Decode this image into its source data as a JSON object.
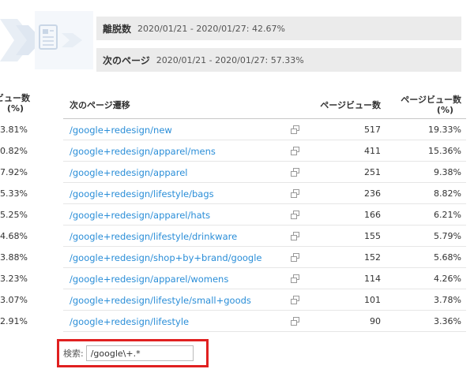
{
  "metrics": {
    "exit": {
      "label": "離脱数",
      "value": "2020/01/21 - 2020/01/27: 42.67%"
    },
    "next": {
      "label": "次のページ",
      "value": "2020/01/21 - 2020/01/27: 57.33%"
    }
  },
  "left_column": {
    "header_line1": "ビュー数",
    "header_line2": "(%)",
    "values": [
      "3.81%",
      "0.82%",
      "7.92%",
      "5.33%",
      "5.25%",
      "4.68%",
      "3.88%",
      "3.23%",
      "3.07%",
      "2.91%"
    ]
  },
  "table": {
    "col_transition": "次のページ遷移",
    "col_pageviews": "ページビュー数",
    "col_pct_line1": "ページビュー数",
    "col_pct_line2": "(%)",
    "rows": [
      {
        "path": "/google+redesign/new",
        "pageviews": "517",
        "pct": "19.33%"
      },
      {
        "path": "/google+redesign/apparel/mens",
        "pageviews": "411",
        "pct": "15.36%"
      },
      {
        "path": "/google+redesign/apparel",
        "pageviews": "251",
        "pct": "9.38%"
      },
      {
        "path": "/google+redesign/lifestyle/bags",
        "pageviews": "236",
        "pct": "8.82%"
      },
      {
        "path": "/google+redesign/apparel/hats",
        "pageviews": "166",
        "pct": "6.21%"
      },
      {
        "path": "/google+redesign/lifestyle/drinkware",
        "pageviews": "155",
        "pct": "5.79%"
      },
      {
        "path": "/google+redesign/shop+by+brand/google",
        "pageviews": "152",
        "pct": "5.68%"
      },
      {
        "path": "/google+redesign/apparel/womens",
        "pageviews": "114",
        "pct": "4.26%"
      },
      {
        "path": "/google+redesign/lifestyle/small+goods",
        "pageviews": "101",
        "pct": "3.78%"
      },
      {
        "path": "/google+redesign/lifestyle",
        "pageviews": "90",
        "pct": "3.36%"
      }
    ]
  },
  "search": {
    "label": "検索:",
    "value": "/google\\+.*"
  },
  "icons": {
    "row_link": "open-in-new-window-icon",
    "page": "document-icon"
  },
  "colors": {
    "link": "#2a8ed8",
    "highlight": "#e02020",
    "metric_bg": "#ebebeb"
  }
}
